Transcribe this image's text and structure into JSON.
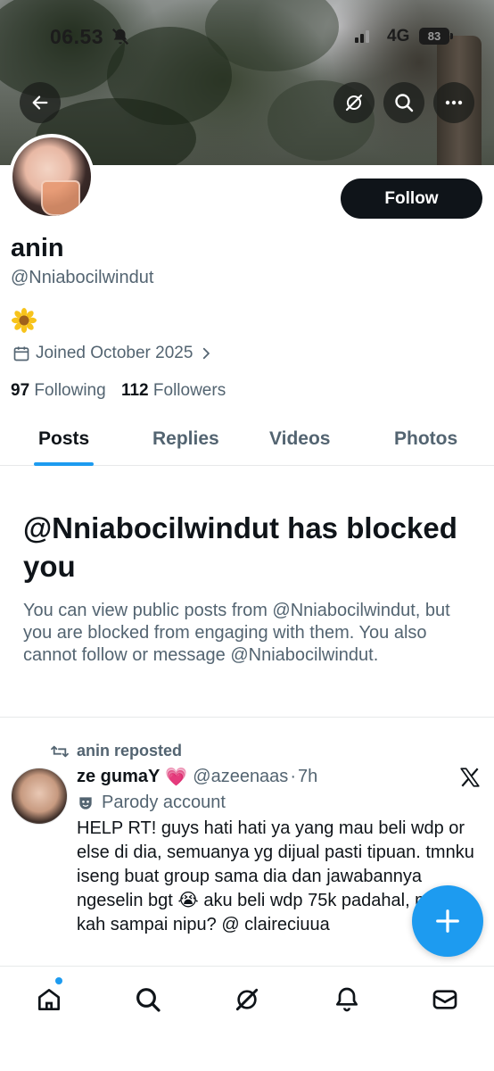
{
  "status_bar": {
    "time": "06.53",
    "network": "4G",
    "battery": "83"
  },
  "header": {
    "back_icon": "arrow-left-icon",
    "grok_icon": "grok-icon",
    "search_icon": "search-icon",
    "more_icon": "more-horizontal-icon"
  },
  "profile": {
    "follow_label": "Follow",
    "display_name": "anin",
    "handle": "@Nniabocilwindut",
    "bio_icon": "sunflower-emoji",
    "joined": "Joined October 2025",
    "following_count": "97",
    "following_label": "Following",
    "followers_count": "112",
    "followers_label": "Followers"
  },
  "tabs": [
    {
      "label": "Posts",
      "active": true
    },
    {
      "label": "Replies",
      "active": false
    },
    {
      "label": "Videos",
      "active": false
    },
    {
      "label": "Photos",
      "active": false
    }
  ],
  "blocked": {
    "title": "@Nniabocilwindut has blocked you",
    "message": "You can view public posts from @Nniabocilwindut, but you are blocked from engaging with them. You also cannot follow or message @Nniabocilwindut."
  },
  "post": {
    "repost_label": "anin reposted",
    "author_name": "ze gumaY",
    "author_emoji": "💗",
    "author_handle": "@azeenaas",
    "separator": "·",
    "time": "7h",
    "parody_label": "Parody account",
    "body": "HELP RT! guys hati hati ya yang mau beli wdp or else di dia, semuanya yg dijual pasti tipuan. tmnku iseng buat group sama dia dan jawabannya ngeselin bgt 😭 aku beli wdp 75k padahal, miskin kah sampai nipu? @ claireciuua"
  },
  "colors": {
    "accent": "#1d9bf0",
    "text_primary": "#0f1419",
    "text_secondary": "#536471"
  },
  "bottom_nav": [
    "home-icon",
    "search-icon",
    "grok-icon",
    "notifications-icon",
    "messages-icon"
  ]
}
